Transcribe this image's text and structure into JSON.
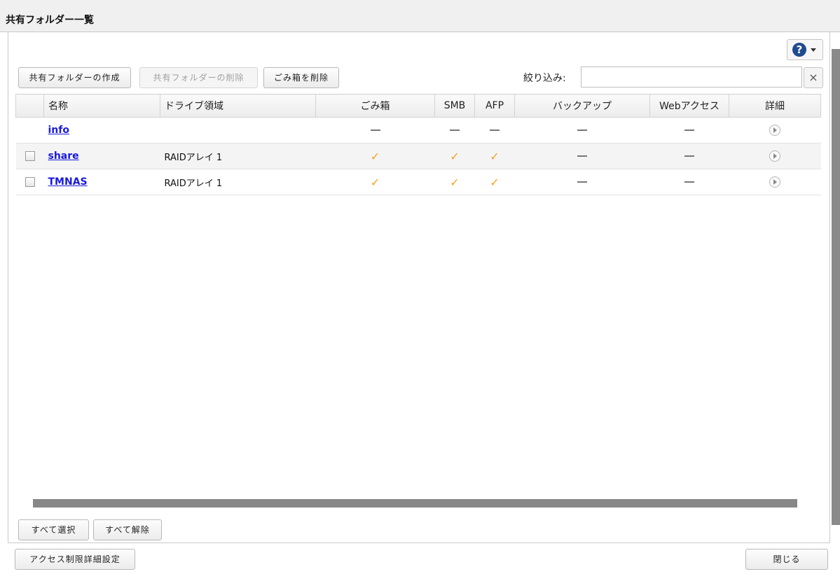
{
  "window": {
    "title": "共有フォルダー一覧"
  },
  "toolbar": {
    "create_label": "共有フォルダーの作成",
    "delete_label": "共有フォルダーの削除",
    "empty_trash_label": "ごみ箱を削除",
    "filter_label": "絞り込み:",
    "filter_value": "",
    "clear_icon": "×",
    "help_icon": "?"
  },
  "table": {
    "headers": {
      "name": "名称",
      "drive": "ドライブ領域",
      "trash": "ごみ箱",
      "smb": "SMB",
      "afp": "AFP",
      "backup": "バックアップ",
      "web": "Webアクセス",
      "detail": "詳細"
    },
    "rows": [
      {
        "name": "info",
        "drive": "",
        "checkbox": false,
        "trash": "dash",
        "smb": "dash",
        "afp": "dash",
        "backup": "dash",
        "web": "dash"
      },
      {
        "name": "share",
        "drive": "RAIDアレイ 1",
        "checkbox": true,
        "trash": "check",
        "smb": "check",
        "afp": "check",
        "backup": "dash",
        "web": "dash"
      },
      {
        "name": "TMNAS",
        "drive": "RAIDアレイ 1",
        "checkbox": true,
        "trash": "check",
        "smb": "check",
        "afp": "check",
        "backup": "dash",
        "web": "dash"
      }
    ],
    "check_glyph": "✓"
  },
  "footer": {
    "select_all_label": "すべて選択",
    "deselect_all_label": "すべて解除",
    "access_settings_label": "アクセス制限詳細設定",
    "close_label": "閉じる"
  },
  "colors": {
    "link": "#1a1ae0",
    "check": "#f5a020",
    "help": "#1f4a8f"
  }
}
